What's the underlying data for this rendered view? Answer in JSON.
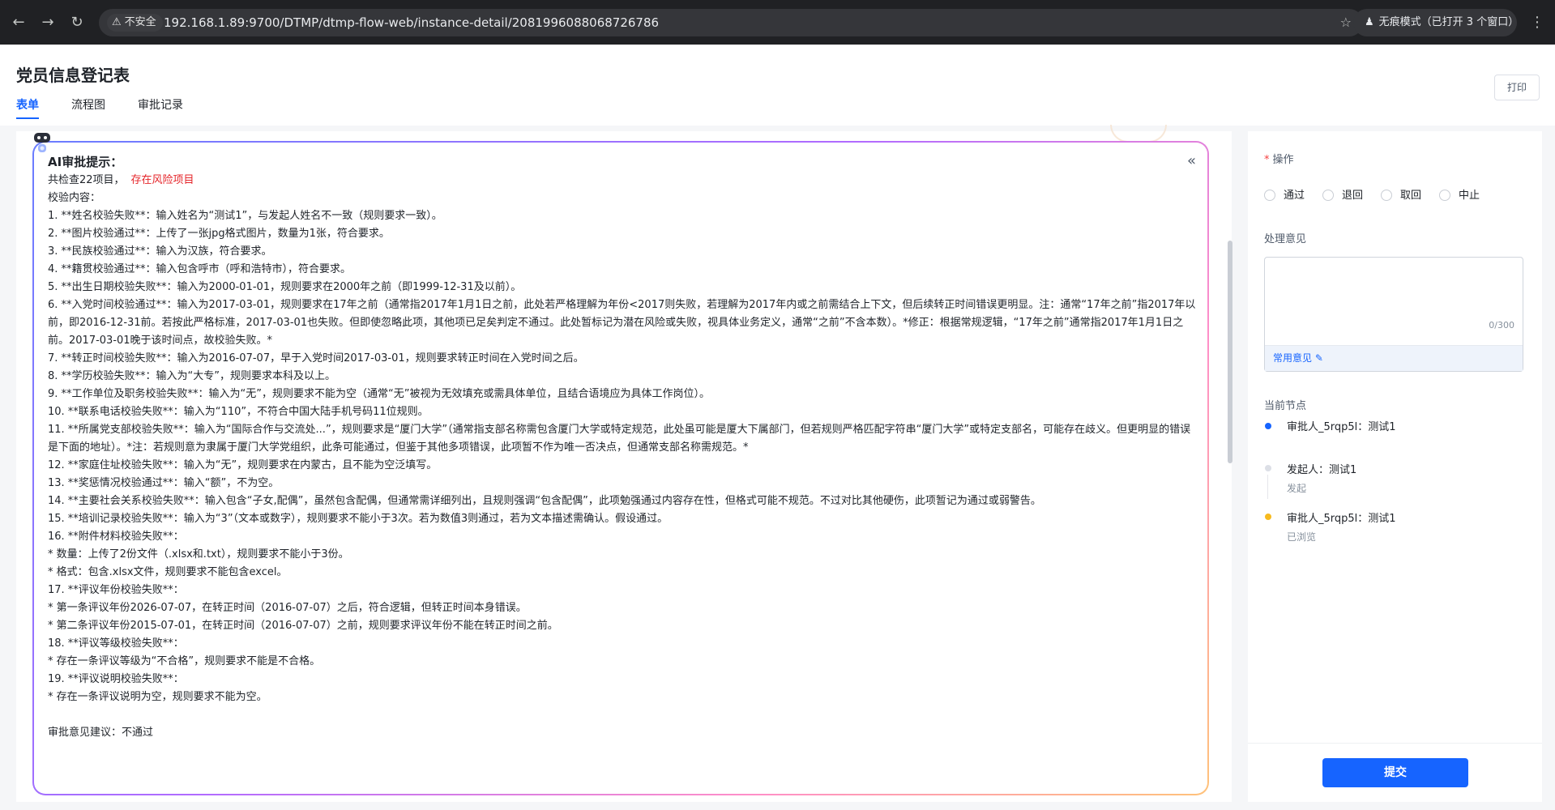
{
  "browser": {
    "security_label": "不安全",
    "url": "192.168.1.89:9700/DTMP/dtmp-flow-web/instance-detail/2081996088068726786",
    "incognito_label": "无痕模式（已打开 3 个窗口）"
  },
  "page": {
    "title": "党员信息登记表",
    "print_label": "打印",
    "tabs": [
      {
        "label": "表单"
      },
      {
        "label": "流程图"
      },
      {
        "label": "审批记录"
      }
    ]
  },
  "ai": {
    "title": "AI审批提示：",
    "summary_prefix": "共检查22项目，",
    "risk_text": "存在风险项目",
    "lines": [
      "校验内容：",
      "1. **姓名校验失败**：输入姓名为“测试1”，与发起人姓名不一致（规则要求一致）。",
      "2. **图片校验通过**：上传了一张jpg格式图片，数量为1张，符合要求。",
      "3. **民族校验通过**：输入为汉族，符合要求。",
      "4. **籍贯校验通过**：输入包含呼市（呼和浩特市），符合要求。",
      "5. **出生日期校验失败**：输入为2000-01-01，规则要求在2000年之前（即1999-12-31及以前）。",
      "6. **入党时间校验通过**：输入为2017-03-01，规则要求在17年之前（通常指2017年1月1日之前，此处若严格理解为年份<2017则失败，若理解为2017年内或之前需结合上下文，但后续转正时间错误更明显。注：通常“17年之前”指2017年以前，即2016-12-31前。若按此严格标准，2017-03-01也失败。但即使忽略此项，其他项已足矣判定不通过。此处暂标记为潜在风险或失败，视具体业务定义，通常“之前”不含本数）。*修正：根据常规逻辑，“17年之前”通常指2017年1月1日之前。2017-03-01晚于该时间点，故校验失败。*",
      "7. **转正时间校验失败**：输入为2016-07-07，早于入党时间2017-03-01，规则要求转正时间在入党时间之后。",
      "8. **学历校验失败**：输入为“大专”，规则要求本科及以上。",
      "9. **工作单位及职务校验失败**：输入为“无”，规则要求不能为空（通常“无”被视为无效填充或需具体单位，且结合语境应为具体工作岗位）。",
      "10. **联系电话校验失败**：输入为“110”，不符合中国大陆手机号码11位规则。",
      "11. **所属党支部校验失败**：输入为“国际合作与交流处...”，规则要求是“厦门大学”（通常指支部名称需包含厦门大学或特定规范，此处虽可能是厦大下属部门，但若规则严格匹配字符串“厦门大学”或特定支部名，可能存在歧义。但更明显的错误是下面的地址）。*注：若规则意为隶属于厦门大学党组织，此条可能通过，但鉴于其他多项错误，此项暂不作为唯一否决点，但通常支部名称需规范。*",
      "12. **家庭住址校验失败**：输入为“无”，规则要求在内蒙古，且不能为空泛填写。",
      "13. **奖惩情况校验通过**：输入“额”，不为空。",
      "14. **主要社会关系校验失败**：输入包含“子女,配偶”，虽然包含配偶，但通常需详细列出，且规则强调“包含配偶”，此项勉强通过内容存在性，但格式可能不规范。不过对比其他硬伤，此项暂记为通过或弱警告。",
      "15. **培训记录校验失败**：输入为“3”（文本或数字），规则要求不能小于3次。若为数值3则通过，若为文本描述需确认。假设通过。",
      "16. **附件材料校验失败**：",
      "* 数量：上传了2份文件（.xlsx和.txt），规则要求不能小于3份。",
      "* 格式：包含.xlsx文件，规则要求不能包含excel。",
      "17. **评议年份校验失败**：",
      "* 第一条评议年份2026-07-07，在转正时间（2016-07-07）之后，符合逻辑，但转正时间本身错误。",
      "* 第二条评议年份2015-07-01，在转正时间（2016-07-07）之前，规则要求评议年份不能在转正时间之前。",
      "18. **评议等级校验失败**：",
      "* 存在一条评议等级为“不合格”，规则要求不能是不合格。",
      "19. **评议说明校验失败**：",
      "* 存在一条评议说明为空，规则要求不能为空。"
    ],
    "suggestion": "审批意见建议：不通过"
  },
  "form": {
    "operation_label": "操作",
    "options": [
      {
        "label": "通过"
      },
      {
        "label": "退回"
      },
      {
        "label": "取回"
      },
      {
        "label": "中止"
      }
    ],
    "comment_label": "处理意见",
    "comment_value": "",
    "counter": "0/300",
    "common_opinion_label": "常用意见"
  },
  "nodes": {
    "label": "当前节点",
    "items": [
      {
        "title": "审批人_5rqp5l：测试1",
        "status": "",
        "color": "#1664ff"
      },
      {
        "title": "发起人：测试1",
        "status": "发起",
        "color": "#dcdfe6"
      },
      {
        "title": "审批人_5rqp5l：测试1",
        "status": "已浏览",
        "color": "#f7ba1e"
      }
    ]
  },
  "submit_label": "提交"
}
